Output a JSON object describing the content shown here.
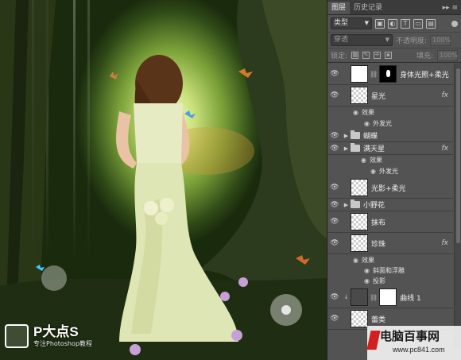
{
  "watermark_left": {
    "title": "P大点S",
    "subtitle": "专注Photoshop教程"
  },
  "watermark_right": {
    "title": "电脑百事网",
    "url": "www.pc841.com"
  },
  "panel": {
    "tabs": [
      "图层",
      "历史记录"
    ],
    "tab_menu": "▸▸ ≡",
    "kind_filter": "类型",
    "filter_icons": [
      "image-filter-icon",
      "adjustment-filter-icon",
      "type-filter-icon",
      "shape-filter-icon",
      "smart-object-filter-icon"
    ],
    "blend_mode": "穿透",
    "opacity_label": "不透明度:",
    "opacity_value": "100%",
    "lock_label": "锁定:",
    "fill_label": "填充:",
    "fill_value": "100%"
  },
  "layers": [
    {
      "name": "身体光照+柔光",
      "kind": "masked",
      "visible": true
    },
    {
      "name": "星光",
      "kind": "layer",
      "fx": "fx",
      "visible": true,
      "effects_label": "效果",
      "effects": [
        "外发光"
      ]
    },
    {
      "name": "蝴蝶",
      "kind": "group",
      "visible": true
    },
    {
      "name": "满天星",
      "kind": "group",
      "fx": "fx",
      "visible": true,
      "effects_label": "效果",
      "effects": [
        "外发光"
      ]
    },
    {
      "name": "光影+柔光",
      "kind": "layer",
      "visible": true
    },
    {
      "name": "小野花",
      "kind": "group",
      "visible": true
    },
    {
      "name": "抹布",
      "kind": "layer",
      "visible": true
    },
    {
      "name": "珍珠",
      "kind": "layer",
      "fx": "fx",
      "visible": true,
      "effects_label": "效果",
      "effects": [
        "斜面和浮雕",
        "投影"
      ]
    },
    {
      "name": "曲线 1",
      "kind": "adjustment",
      "visible": true
    },
    {
      "name": "蕾类",
      "kind": "layer",
      "visible": true
    }
  ],
  "colors": {
    "panel_bg": "#535353",
    "tab_bar": "#3b3b3b",
    "accent": "#d02020"
  }
}
